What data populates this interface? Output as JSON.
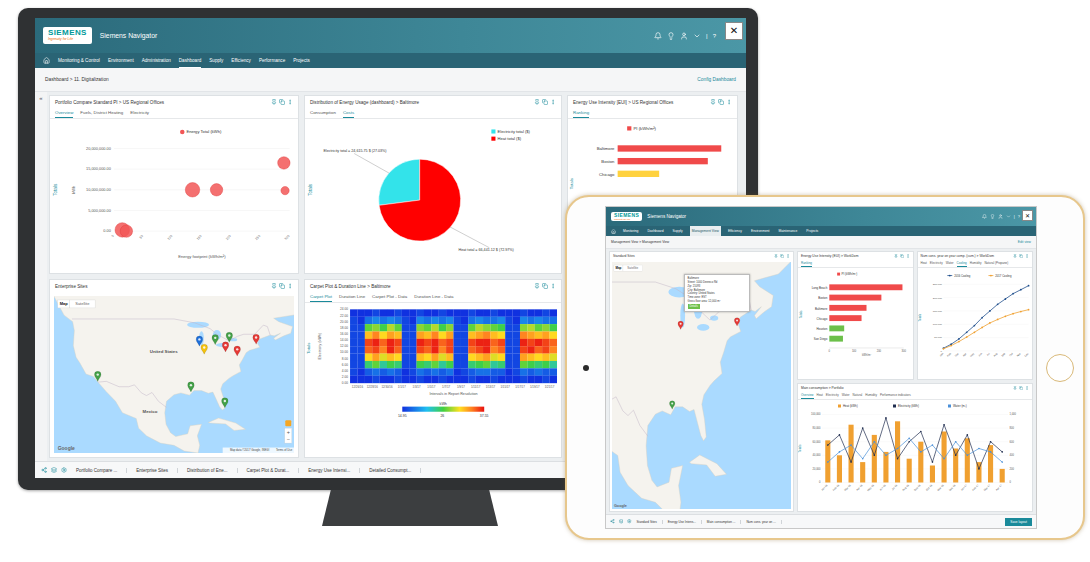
{
  "monitor": {
    "header": {
      "logo": "SIEMENS",
      "tagline": "Ingenuity for Life",
      "title": "Siemens Navigator",
      "divider": "|",
      "help": "?"
    },
    "close": "✕",
    "nav": [
      {
        "label": "Monitoring & Control",
        "selected": false
      },
      {
        "label": "Environment",
        "selected": false
      },
      {
        "label": "Administration",
        "selected": false
      },
      {
        "label": "Dashboard",
        "selected": true
      },
      {
        "label": "Supply",
        "selected": false
      },
      {
        "label": "Efficiency",
        "selected": false
      },
      {
        "label": "Performance",
        "selected": false
      },
      {
        "label": "Projects",
        "selected": false
      }
    ],
    "breadcrumb": "Dashboard > 11. Digitalization",
    "config": "Config Dashboard",
    "collapse": "«",
    "portfolio": {
      "title": "Portfolio Compare Standard PI > US Regional Offices",
      "tabs": [
        {
          "label": "Overview",
          "selected": true
        },
        {
          "label": "Fuels, District Heating",
          "selected": false
        },
        {
          "label": "Electricity",
          "selected": false
        }
      ],
      "side_label": "Totals",
      "legend": "Energy Total (kWh)",
      "y_label": "kWh",
      "y_ticks": [
        "20,000,000.00",
        "15,000,000.00",
        "10,000,000.00",
        "5,000,000.00",
        "0.00"
      ],
      "x_ticks": [
        "0",
        "50",
        "100",
        "150",
        "200",
        "250",
        "300"
      ],
      "x_label": "Energy footprint (kWh/m²)",
      "bubbles": [
        {
          "x": 290,
          "y": 16500000,
          "size": 6
        },
        {
          "x": 134,
          "y": 10000000,
          "size": 7
        },
        {
          "x": 175,
          "y": 10000000,
          "size": 6
        },
        {
          "x": 292,
          "y": 9800000,
          "size": 4
        },
        {
          "x": 14,
          "y": 300000,
          "size": 7
        },
        {
          "x": 21,
          "y": 0,
          "size": 6
        }
      ]
    },
    "distribution": {
      "title": "Distribution of Energy Usage (dashboard) > Baltimore",
      "tabs": [
        {
          "label": "Consumption",
          "selected": false
        },
        {
          "label": "Costs",
          "selected": true
        }
      ],
      "side_label": "Totals",
      "slices": [
        {
          "label": "Electricity total ($)",
          "value": 24615.75,
          "color": "#33e3ea",
          "callout": "Electricity total = 24,615.75 $ (27.03%)"
        },
        {
          "label": "Heat total ($)",
          "value": 66441.12,
          "color": "#ff0000",
          "callout": "Heat total = 66,441.12 $ (72.97%)"
        }
      ]
    },
    "eui": {
      "title": "Energy Use Intensity [EUI] > US Regional Offices",
      "tabs": [
        {
          "label": "Ranking",
          "selected": true
        }
      ],
      "side_label": "Totals",
      "legend": "PI (kWh/m²)",
      "bars": [
        {
          "label": "Baltimore",
          "value": 262,
          "color": "#f04a4a"
        },
        {
          "label": "Boston",
          "value": 228,
          "color": "#f04a4a"
        },
        {
          "label": "Chicago",
          "value": 105,
          "color": "#ffd23f"
        }
      ]
    },
    "sites": {
      "title": "Enterprise Sites",
      "tabs": [
        {
          "label": "Map",
          "selected": true
        },
        {
          "label": "Satellite",
          "selected": false
        }
      ],
      "country_labels": [
        "United States",
        "Mexico"
      ],
      "logo": "Google",
      "attribution": "Map data ©2017 Google, INEGI",
      "terms": "Terms of Use",
      "zoom": [
        "+",
        "−"
      ],
      "pins": [
        {
          "lat": 32.7,
          "lon": -117.2,
          "color": "#43a047"
        },
        {
          "lat": 41.9,
          "lon": -87.6,
          "color": "#1e6fd9"
        },
        {
          "lat": 42.3,
          "lon": -83.0,
          "color": "#43a047"
        },
        {
          "lat": 39.8,
          "lon": -86.2,
          "color": "#f4c20d"
        },
        {
          "lat": 39.3,
          "lon": -76.6,
          "color": "#e53935"
        },
        {
          "lat": 40.4,
          "lon": -80.0,
          "color": "#e53935"
        },
        {
          "lat": 42.9,
          "lon": -78.9,
          "color": "#43a047"
        },
        {
          "lat": 42.4,
          "lon": -71.1,
          "color": "#e53935"
        },
        {
          "lat": 29.95,
          "lon": -90.07,
          "color": "#43a047"
        },
        {
          "lat": 25.8,
          "lon": -80.2,
          "color": "#43a047"
        }
      ]
    },
    "carpet": {
      "title": "Carpet Plot & Duration Line > Baltimore",
      "tabs": [
        {
          "label": "Carpet Plot",
          "selected": true
        },
        {
          "label": "Duration Line",
          "selected": false
        },
        {
          "label": "Carpet Plot - Data",
          "selected": false
        },
        {
          "label": "Duration Line - Data",
          "selected": false
        }
      ],
      "side_label": "Totals",
      "y_label": "Electricity (kWh)",
      "y_ticks": [
        "24.00",
        "22.00",
        "20.00",
        "18.00",
        "16.00",
        "14.00",
        "12.00",
        "10.00",
        "8.00",
        "6.00",
        "4.00",
        "2.00",
        "0.00"
      ],
      "x_ticks": [
        "12/26/16",
        "12/28/16",
        "12/30/16",
        "1/1/17",
        "1/3/17",
        "1/5/17",
        "1/7/17",
        "1/9/17",
        "1/11/17",
        "1/13/17",
        "1/15/17",
        "1/17/17",
        "1/19/17",
        "1/21/17"
      ],
      "x_label": "Intervals in Report Resolution",
      "values": [
        [
          15,
          15,
          15,
          16,
          15,
          15,
          16,
          15,
          15,
          16,
          15,
          15,
          16,
          15,
          15,
          15,
          16,
          15,
          15,
          16,
          15,
          15,
          15,
          16,
          15,
          15,
          16,
          15
        ],
        [
          16,
          15,
          18,
          19,
          18,
          19,
          18,
          16,
          15,
          19,
          18,
          19,
          18,
          19,
          16,
          15,
          18,
          19,
          18,
          18,
          19,
          16,
          15,
          19,
          18,
          19,
          18,
          18
        ],
        [
          16,
          16,
          27,
          28,
          26,
          29,
          27,
          16,
          16,
          28,
          27,
          29,
          26,
          28,
          16,
          16,
          27,
          29,
          28,
          27,
          26,
          16,
          16,
          28,
          29,
          27,
          28,
          26
        ],
        [
          16,
          16,
          32,
          34,
          31,
          33,
          32,
          16,
          16,
          33,
          32,
          34,
          31,
          33,
          16,
          16,
          32,
          33,
          34,
          32,
          31,
          16,
          16,
          34,
          33,
          32,
          33,
          31
        ],
        [
          16,
          16,
          36,
          37,
          35,
          37,
          36,
          16,
          16,
          37,
          36,
          37,
          35,
          36,
          16,
          16,
          36,
          37,
          37,
          35,
          36,
          16,
          16,
          37,
          36,
          37,
          36,
          35
        ],
        [
          16,
          16,
          35,
          36,
          34,
          37,
          35,
          16,
          16,
          36,
          35,
          37,
          34,
          36,
          16,
          16,
          35,
          36,
          37,
          34,
          35,
          16,
          16,
          36,
          37,
          35,
          36,
          34
        ],
        [
          16,
          16,
          31,
          33,
          30,
          32,
          31,
          16,
          16,
          32,
          31,
          33,
          30,
          32,
          16,
          16,
          31,
          32,
          33,
          30,
          31,
          16,
          16,
          33,
          32,
          31,
          32,
          30
        ],
        [
          16,
          16,
          25,
          27,
          24,
          26,
          25,
          16,
          16,
          26,
          25,
          27,
          24,
          26,
          16,
          16,
          25,
          26,
          27,
          24,
          25,
          16,
          16,
          27,
          26,
          25,
          26,
          24
        ],
        [
          16,
          15,
          17,
          18,
          17,
          18,
          17,
          15,
          16,
          18,
          17,
          18,
          17,
          18,
          15,
          16,
          17,
          18,
          18,
          17,
          17,
          15,
          16,
          18,
          17,
          18,
          17,
          17
        ],
        [
          15,
          15,
          15,
          16,
          15,
          15,
          16,
          15,
          15,
          16,
          15,
          15,
          16,
          15,
          15,
          15,
          16,
          15,
          15,
          16,
          15,
          15,
          15,
          16,
          15,
          15,
          16,
          15
        ]
      ],
      "scale": {
        "title": "kWh",
        "ticks": [
          "14.95",
          "26",
          "37.55"
        ]
      }
    },
    "taskbar": [
      "Portfolio Compare ...",
      "Enterprise Sites",
      "Distribution of Ene...",
      "Carpet Plot & Durat...",
      "Energy Use Intensi...",
      "Detailed Consumpt..."
    ]
  },
  "tablet": {
    "header": {
      "logo": "SIEMENS",
      "tagline": "Ingenuity for Life",
      "title": "Siemens Navigator",
      "divider": "|",
      "help": "?"
    },
    "close": "✕",
    "nav": [
      {
        "label": "Monitoring",
        "selected": false
      },
      {
        "label": "Dashboard",
        "selected": false
      },
      {
        "label": "Supply",
        "selected": false
      },
      {
        "label": "Management View",
        "selected": true
      },
      {
        "label": "Efficiency",
        "selected": false
      },
      {
        "label": "Environment",
        "selected": false
      },
      {
        "label": "Maintenance",
        "selected": false
      },
      {
        "label": "Projects",
        "selected": false
      }
    ],
    "breadcrumb": "Management View > Management View",
    "edit": "Edit view",
    "sites": {
      "title": "Standard Sites",
      "tabs": [
        {
          "label": "Map",
          "selected": true
        },
        {
          "label": "Satellite",
          "selected": false
        }
      ],
      "logo": "Google",
      "pins": [
        {
          "lat": 41.9,
          "lon": -87.6,
          "color": "#e53935"
        },
        {
          "lat": 42.4,
          "lon": -71.1,
          "color": "#e53935"
        },
        {
          "lat": 29.95,
          "lon": -90.07,
          "color": "#43a047"
        }
      ],
      "popup": {
        "lines": [
          "Baltimore",
          "Street: 1000 Deereco Rd",
          "Zip: 21093",
          "City: Baltimore",
          "Country: United States",
          "Time zone: EST",
          "Gross floor area: 12,000 m²"
        ],
        "badge": "Details"
      }
    },
    "eui": {
      "title": "Energy Use Intensity (EUI) > WorkDom",
      "tabs": [
        {
          "label": "Ranking",
          "selected": true
        }
      ],
      "side_label": "Totals",
      "legend": "PI (kWh/m²)",
      "bars": [
        {
          "label": "Long Beach",
          "value": 295,
          "color": "#f04a4a"
        },
        {
          "label": "Boston",
          "value": 210,
          "color": "#f04a4a"
        },
        {
          "label": "Baltimore",
          "value": 150,
          "color": "#f04a4a"
        },
        {
          "label": "Chicago",
          "value": 130,
          "color": "#f04a4a"
        },
        {
          "label": "Houston",
          "value": 60,
          "color": "#6cc04a"
        },
        {
          "label": "San Diego",
          "value": 55,
          "color": "#6cc04a"
        }
      ],
      "x_ticks": [
        "0",
        "100",
        "200",
        "300"
      ],
      "x_label": "kWh/m²"
    },
    "yoy": {
      "title": "Num cons. year on year comp. (cum.) > WorkDom",
      "tabs": [
        {
          "label": "Heat",
          "selected": false
        },
        {
          "label": "Electricity",
          "selected": false
        },
        {
          "label": "Water",
          "selected": false
        },
        {
          "label": "Cooling",
          "selected": true
        },
        {
          "label": "Humidity",
          "selected": false
        },
        {
          "label": "Natural (Propane)",
          "selected": false
        }
      ],
      "side_label": "Totals",
      "y_ticks": [
        "0",
        "50,000",
        "100,000",
        "150,000",
        "200,000",
        "250,000"
      ],
      "x_ticks": [
        "Jan",
        "Feb",
        "Mar",
        "Apr",
        "May",
        "Jun",
        "Jul",
        "Aug",
        "Sep",
        "Oct",
        "Nov",
        "Dec"
      ],
      "series": [
        {
          "label": "2016 Cooling",
          "color": "#1f4e8c",
          "values": [
            10000,
            25000,
            45000,
            70000,
            95000,
            125000,
            150000,
            175000,
            195000,
            215000,
            230000,
            245000
          ]
        },
        {
          "label": "2017 Cooling",
          "color": "#f0a030",
          "values": [
            8000,
            20000,
            35000,
            52000,
            70000,
            88000,
            105000,
            118000,
            130000,
            140000,
            148000,
            155000
          ]
        }
      ]
    },
    "main": {
      "title": "Main consumption > Portfolio",
      "tabs": [
        {
          "label": "Overview",
          "selected": true
        },
        {
          "label": "Heat",
          "selected": false
        },
        {
          "label": "Electricity",
          "selected": false
        },
        {
          "label": "Water",
          "selected": false
        },
        {
          "label": "Natural",
          "selected": false
        },
        {
          "label": "Humidity",
          "selected": false
        },
        {
          "label": "Performance indicators",
          "selected": false
        }
      ],
      "side_label": "Totals",
      "y_ticks": [
        "0",
        "20,000",
        "40,000",
        "60,000",
        "80,000",
        "100,000"
      ],
      "y2_ticks": [
        "0",
        "200",
        "400",
        "600",
        "800",
        "1,000"
      ],
      "x_ticks": [
        "Jan 16",
        "Feb 16",
        "Mar 16",
        "Apr 16",
        "May 16",
        "Jun 16",
        "Jul 16",
        "Aug 16",
        "Sep 16",
        "Oct 16",
        "Nov 16",
        "Dec 16",
        "Jan 17",
        "Feb 17",
        "Mar 17",
        "Apr 17"
      ],
      "series": [
        {
          "label": "Heat (kWh)",
          "color": "#f0a030",
          "kind": "bar",
          "axis": "left",
          "values": [
            62000,
            40000,
            85000,
            30000,
            70000,
            45000,
            90000,
            35000,
            60000,
            25000,
            75000,
            50000,
            65000,
            30000,
            55000,
            20000
          ]
        },
        {
          "label": "Electricity (kWh)",
          "color": "#1f2d4f",
          "kind": "line",
          "axis": "left",
          "values": [
            55000,
            70000,
            30000,
            80000,
            40000,
            95000,
            35000,
            60000,
            75000,
            30000,
            85000,
            40000,
            70000,
            20000,
            60000,
            45000
          ]
        },
        {
          "label": "Water (m³)",
          "color": "#4a90d9",
          "kind": "line",
          "axis": "right",
          "values": [
            300,
            450,
            550,
            350,
            600,
            400,
            500,
            650,
            450,
            550,
            350,
            600,
            400,
            500,
            450,
            300
          ]
        }
      ]
    },
    "taskbar": [
      "Standard Sites",
      "Energy Use Intens...",
      "Main consumption ...",
      "Num cons. year on ..."
    ],
    "save": "Save layout"
  }
}
